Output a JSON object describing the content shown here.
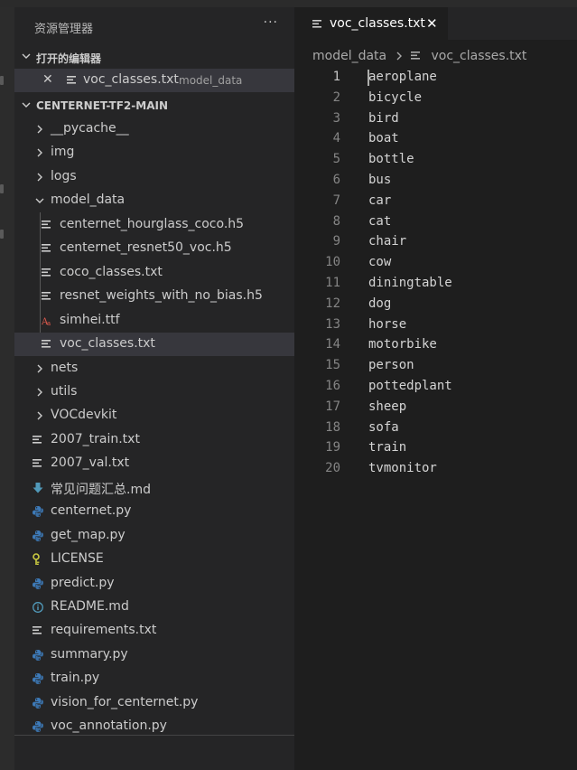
{
  "sidebar": {
    "title": "资源管理器",
    "more": "···",
    "open_editors": {
      "label": "打开的编辑器",
      "items": [
        {
          "file": "voc_classes.txt",
          "dir": "model_data"
        }
      ]
    },
    "project": {
      "label": "CENTERNET-TF2-MAIN",
      "tree": [
        {
          "label": "__pycache__",
          "type": "folder",
          "state": "collapsed"
        },
        {
          "label": "img",
          "type": "folder",
          "state": "collapsed"
        },
        {
          "label": "logs",
          "type": "folder",
          "state": "collapsed"
        },
        {
          "label": "model_data",
          "type": "folder",
          "state": "expanded"
        },
        {
          "label": "centernet_hourglass_coco.h5",
          "type": "lines-icon"
        },
        {
          "label": "centernet_resnet50_voc.h5",
          "type": "lines-icon"
        },
        {
          "label": "coco_classes.txt",
          "type": "lines-icon"
        },
        {
          "label": "resnet_weights_with_no_bias.h5",
          "type": "lines-icon"
        },
        {
          "label": "simhei.ttf",
          "type": "font-icon"
        },
        {
          "label": "voc_classes.txt",
          "type": "lines-icon",
          "selected": true
        },
        {
          "label": "nets",
          "type": "folder",
          "state": "collapsed"
        },
        {
          "label": "utils",
          "type": "folder",
          "state": "collapsed"
        },
        {
          "label": "VOCdevkit",
          "type": "folder",
          "state": "collapsed"
        },
        {
          "label": "2007_train.txt",
          "type": "lines-icon"
        },
        {
          "label": "2007_val.txt",
          "type": "lines-icon"
        },
        {
          "label": "常见问题汇总.md",
          "type": "download-arrow-icon"
        },
        {
          "label": "centernet.py",
          "type": "python-icon"
        },
        {
          "label": "get_map.py",
          "type": "python-icon"
        },
        {
          "label": "LICENSE",
          "type": "license-icon"
        },
        {
          "label": "predict.py",
          "type": "python-icon"
        },
        {
          "label": "README.md",
          "type": "info-icon"
        },
        {
          "label": "requirements.txt",
          "type": "lines-icon"
        },
        {
          "label": "summary.py",
          "type": "python-icon"
        },
        {
          "label": "train.py",
          "type": "python-icon"
        },
        {
          "label": "vision_for_centernet.py",
          "type": "python-icon"
        },
        {
          "label": "voc_annotation.py",
          "type": "python-icon"
        }
      ]
    }
  },
  "editor": {
    "tab": {
      "label": "voc_classes.txt",
      "close": "✕"
    },
    "breadcrumb": {
      "folder": "model_data",
      "file": "voc_classes.txt"
    },
    "current_line": 1,
    "lines": [
      {
        "no": "1",
        "text": "aeroplane"
      },
      {
        "no": "2",
        "text": "bicycle"
      },
      {
        "no": "3",
        "text": "bird"
      },
      {
        "no": "4",
        "text": "boat"
      },
      {
        "no": "5",
        "text": "bottle"
      },
      {
        "no": "6",
        "text": "bus"
      },
      {
        "no": "7",
        "text": "car"
      },
      {
        "no": "8",
        "text": "cat"
      },
      {
        "no": "9",
        "text": "chair"
      },
      {
        "no": "10",
        "text": "cow"
      },
      {
        "no": "11",
        "text": "diningtable"
      },
      {
        "no": "12",
        "text": "dog"
      },
      {
        "no": "13",
        "text": "horse"
      },
      {
        "no": "14",
        "text": "motorbike"
      },
      {
        "no": "15",
        "text": "person"
      },
      {
        "no": "16",
        "text": "pottedplant"
      },
      {
        "no": "17",
        "text": "sheep"
      },
      {
        "no": "18",
        "text": "sofa"
      },
      {
        "no": "19",
        "text": "train"
      },
      {
        "no": "20",
        "text": "tvmonitor"
      }
    ]
  },
  "colors": {
    "python": "#3d7ab8",
    "license": "#cbcb41",
    "font": "#e05a4d",
    "info": "#519aba",
    "lines": "#cccccc"
  }
}
